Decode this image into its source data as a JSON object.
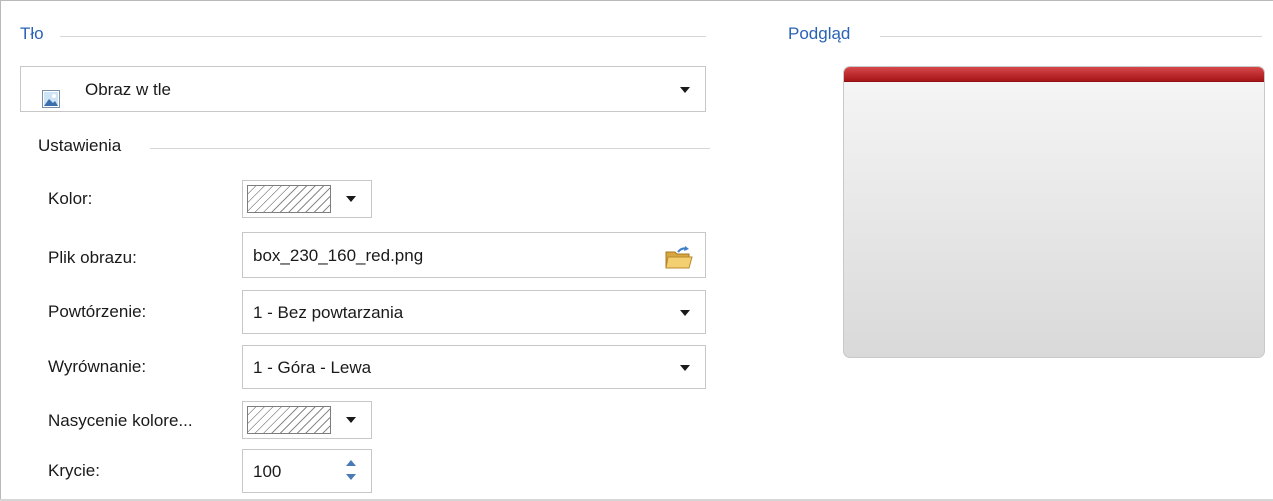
{
  "background_group": {
    "title": "Tło"
  },
  "background_type": {
    "value": "Obraz w tle",
    "icon": "image-icon"
  },
  "settings": {
    "title": "Ustawienia",
    "color": {
      "label": "Kolor:"
    },
    "image_file": {
      "label": "Plik obrazu:",
      "value": "box_230_160_red.png",
      "icon": "open-folder-icon"
    },
    "repeat": {
      "label": "Powtórzenie:",
      "value": "1 - Bez powtarzania"
    },
    "alignment": {
      "label": "Wyrównanie:",
      "value": "1 - Góra - Lewa"
    },
    "saturation": {
      "label": "Nasycenie kolore..."
    },
    "opacity": {
      "label": "Krycie:",
      "value": "100"
    }
  },
  "preview": {
    "title": "Podgląd",
    "header_color": "#b71c1f"
  }
}
